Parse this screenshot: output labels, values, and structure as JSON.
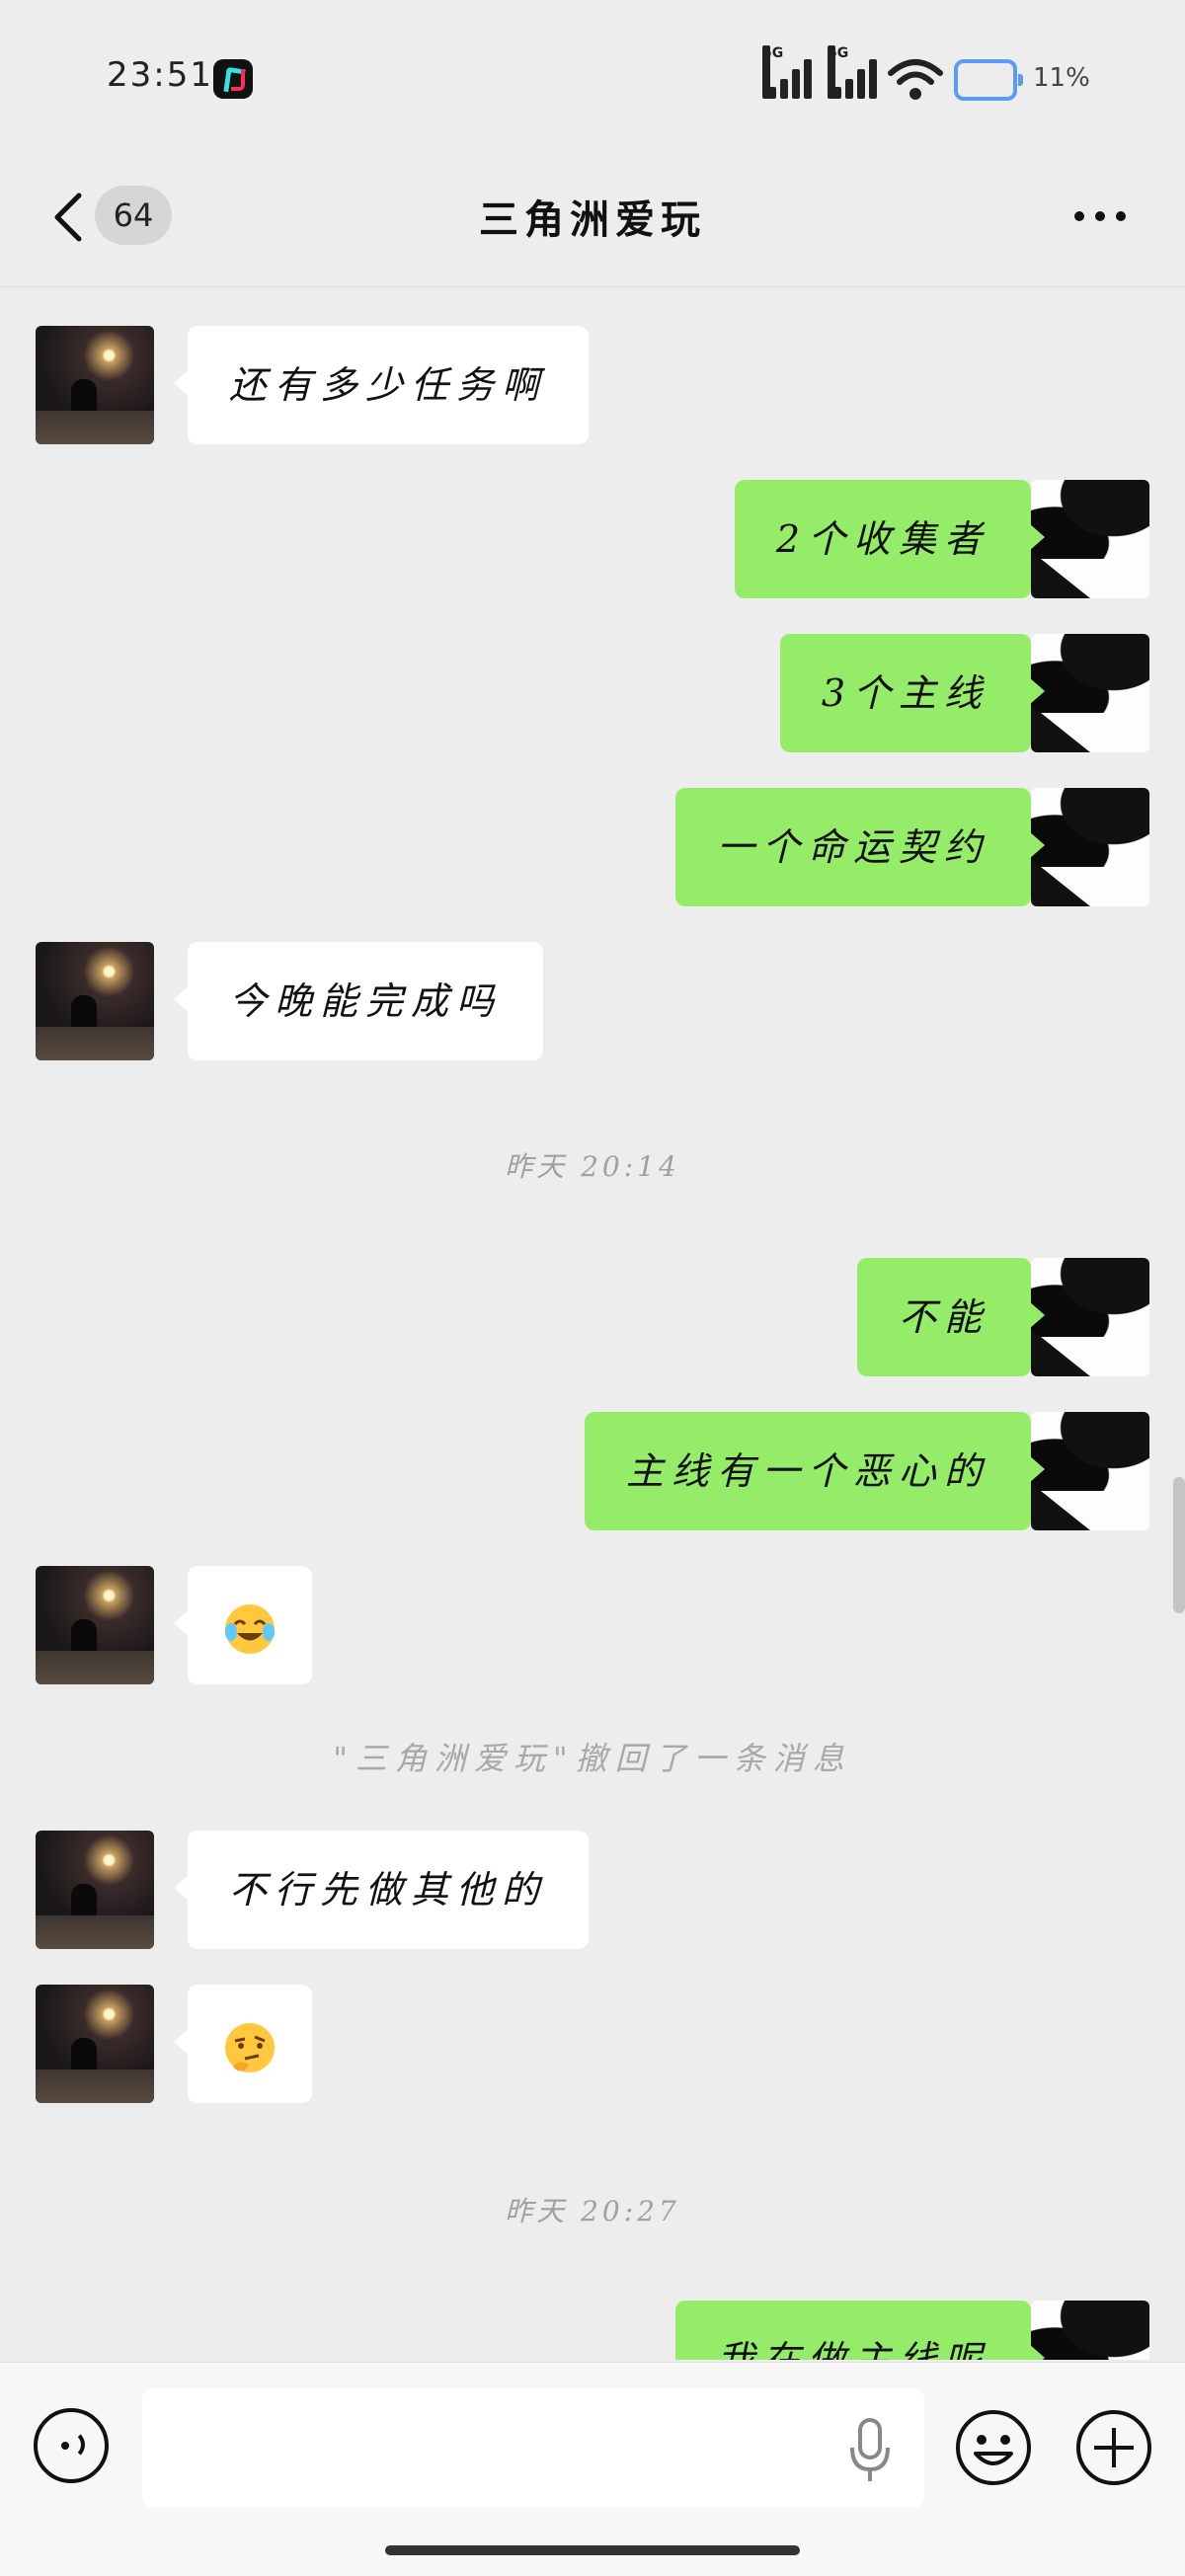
{
  "status_bar": {
    "time": "23:51",
    "network_tag_1": "5G",
    "network_tag_2": "5G",
    "battery_percent": "11%",
    "battery_level": 0.11,
    "accent_battery": "#5b9cf0"
  },
  "nav": {
    "unread_count": "64",
    "title": "三角洲爱玩",
    "back_icon": "chevron-left-icon",
    "more_icon": "more-dots-icon"
  },
  "messages": [
    {
      "side": "left",
      "text": "还有多少任务啊"
    },
    {
      "side": "right",
      "text": "2个收集者"
    },
    {
      "side": "right",
      "text": "3个主线"
    },
    {
      "side": "right",
      "text": "一个命运契约"
    },
    {
      "side": "left",
      "text": "今晚能完成吗"
    },
    {
      "type": "timestamp",
      "text": "昨天 20:14"
    },
    {
      "side": "right",
      "text": "不能"
    },
    {
      "side": "right",
      "text": "主线有一个恶心的"
    },
    {
      "side": "left",
      "emoji": "crying-laughing-emoji"
    },
    {
      "type": "recall",
      "text": "\"三角洲爱玩\"撤回了一条消息"
    },
    {
      "side": "left",
      "text": "不行先做其他的"
    },
    {
      "side": "left",
      "emoji": "thinking-emoji"
    },
    {
      "type": "timestamp",
      "text": "昨天 20:27"
    },
    {
      "side": "right",
      "text": "我在做主线呢"
    }
  ],
  "input_bar": {
    "placeholder": "",
    "voice_icon": "voice-toggle-icon",
    "mic_icon": "microphone-icon",
    "emoji_icon": "emoji-icon",
    "plus_icon": "plus-icon"
  },
  "colors": {
    "background": "#ededed",
    "own_bubble": "#95ec69",
    "other_bubble": "#ffffff"
  }
}
